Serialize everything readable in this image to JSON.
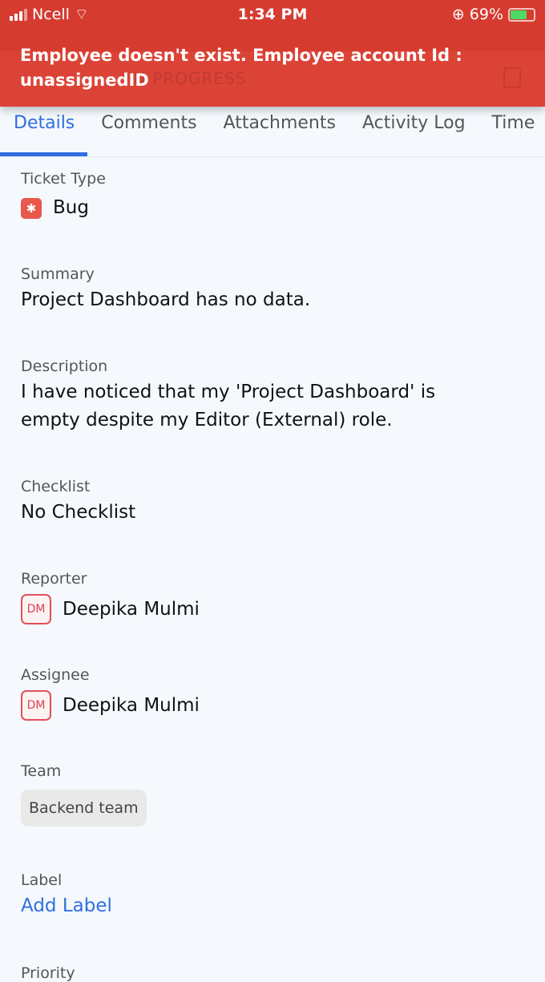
{
  "status_bar": {
    "carrier": "Ncell",
    "time": "1:34 PM",
    "battery": "69%"
  },
  "header": {
    "status_dropdown": "IN PROGRESS"
  },
  "toast": {
    "message": "Employee doesn't exist. Employee account Id : unassignedID"
  },
  "tabs": [
    {
      "label": "Details"
    },
    {
      "label": "Comments"
    },
    {
      "label": "Attachments"
    },
    {
      "label": "Activity Log"
    },
    {
      "label": "Time"
    }
  ],
  "details": {
    "ticket_type": {
      "label": "Ticket Type",
      "value": "Bug"
    },
    "summary": {
      "label": "Summary",
      "value": "Project Dashboard has no data."
    },
    "description": {
      "label": "Description",
      "value": "I have noticed that my 'Project Dashboard' is empty  despite my Editor (External) role."
    },
    "checklist": {
      "label": "Checklist",
      "value": "No Checklist"
    },
    "reporter": {
      "label": "Reporter",
      "initials": "DM",
      "name": "Deepika Mulmi"
    },
    "assignee": {
      "label": "Assignee",
      "initials": "DM",
      "name": "Deepika Mulmi"
    },
    "team": {
      "label": "Team",
      "value": "Backend team"
    },
    "label": {
      "label": "Label",
      "action": "Add Label"
    },
    "priority": {
      "label": "Priority"
    }
  },
  "colors": {
    "accent": "#2f6fe0",
    "toast": "#d63b30",
    "bug": "#e8584c"
  }
}
